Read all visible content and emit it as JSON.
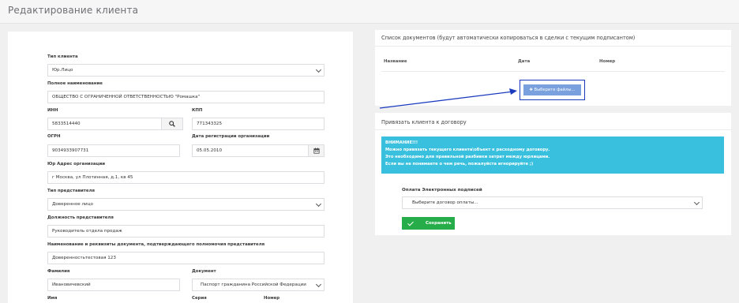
{
  "page": {
    "title": "Редактирование клиента"
  },
  "form": {
    "client_type": {
      "label": "Тип клиента",
      "value": "Юр.Лицо"
    },
    "full_name": {
      "label": "Полное наименование",
      "value": "ОБЩЕСТВО С ОГРАНИЧЕННОЙ ОТВЕТСТВЕННОСТЬЮ \"Ромашка\""
    },
    "inn": {
      "label": "ИНН",
      "value": "5833514440"
    },
    "kpp": {
      "label": "КПП",
      "value": "771343325"
    },
    "ogrn": {
      "label": "ОГРН",
      "value": "9034933907731"
    },
    "reg_date": {
      "label": "Дата регистрации организации",
      "value": "05.05.2010"
    },
    "address": {
      "label": "Юр Адрес организации",
      "value": "г Москва, ул Плотинная, д.1, кв 45"
    },
    "rep_type": {
      "label": "Тип представителя",
      "value": "Доверенное лицо"
    },
    "rep_position": {
      "label": "Должность представителя",
      "value": "Руководитель отдела продаж"
    },
    "authority_doc": {
      "label": "Наименование и реквизиты документа, подтверждающего полномочия представителя",
      "value": "Доверенностьтестовая 123"
    },
    "last_name": {
      "label": "Фамилия",
      "value": "Ивановичевский"
    },
    "document": {
      "label": "Документ",
      "value": "Паспорт гражданина Российской Федерации"
    },
    "first_name": {
      "label": "Имя"
    },
    "series": {
      "label": "Серия"
    },
    "number": {
      "label": "Номер"
    }
  },
  "documents": {
    "title": "Список документов (будут автоматически копироваться в сделки с текущим подписантом)",
    "columns": [
      "Название",
      "Дата",
      "Номер"
    ],
    "upload_label": "Выберите файлы..."
  },
  "contract": {
    "title": "Привязать клиента к договору",
    "alert_title": "ВНИМАНИЕ!!!",
    "alert_lines": [
      "Можно привязать текущего клиента\\объект к расходному договору.",
      "Это необходимо для правильной разбивки затрат между юрлицами.",
      "Если вы не понимаете о чем речь, пожалуйста игнорируйте ;)"
    ],
    "payment_label": "Оплата Электронных подписей",
    "payment_value": "Выберите договор оплаты...",
    "save_label": "Сохранить"
  },
  "colors": {
    "accent": "#7aa0dd",
    "highlight": "#1b3bbf",
    "info": "#39c0de",
    "success": "#26ac48"
  },
  "icons": [
    "search-icon",
    "calendar-icon",
    "chevron-down-icon",
    "plus-icon",
    "check-icon",
    "arrow-pointer"
  ]
}
